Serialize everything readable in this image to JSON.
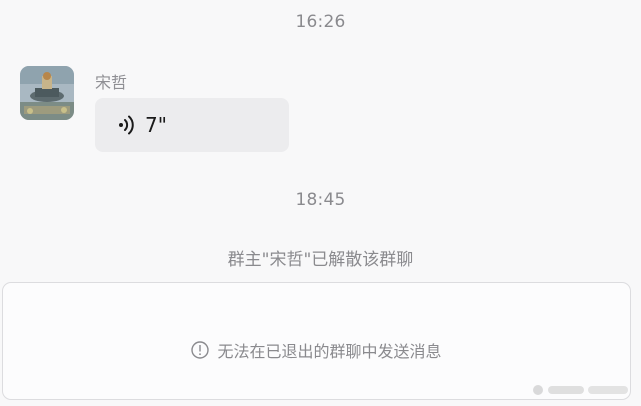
{
  "chat": {
    "timestamp_1": "16:26",
    "timestamp_2": "18:45",
    "message": {
      "sender_name": "宋哲",
      "type": "voice",
      "voice_icon": "voice-wave-icon",
      "duration": "7\""
    },
    "system_notice": "群主\"宋哲\"已解散该群聊"
  },
  "input_area": {
    "disabled_hint": "无法在已退出的群聊中发送消息",
    "hint_icon": "info-circle-icon"
  },
  "colors": {
    "background": "#f8f8f9",
    "bubble": "#ececee",
    "muted_text": "#8a8a8e",
    "primary_text": "#1a1a1a",
    "input_border": "#dcdcdf"
  }
}
